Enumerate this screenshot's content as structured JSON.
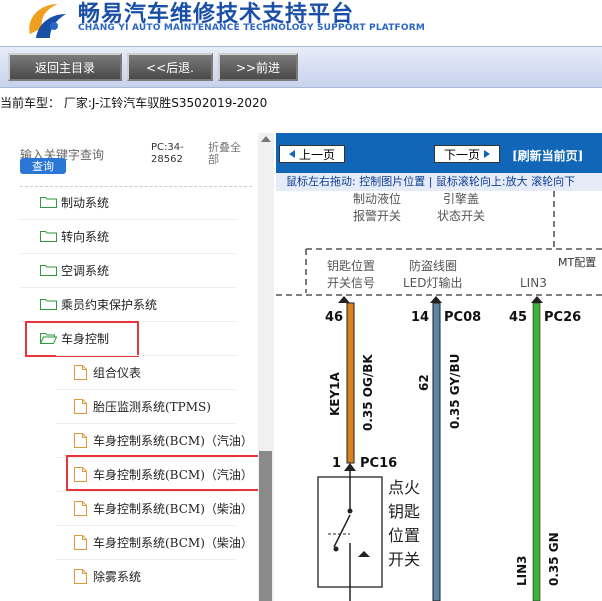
{
  "header": {
    "title": "畅易汽车维修技术支持平台",
    "subtitle": "CHANG YI AUTO MAINTENANCE TECHNOLOGY SUPPORT PLATFORM"
  },
  "nav": {
    "home": "返回主目录",
    "back": "<<后退.",
    "forward": ">>前进"
  },
  "vehicle": "当前车型： 厂家:J-江铃汽车驭胜S3502019-2020",
  "sidebar": {
    "search_hint": "输入关键字查询",
    "search_button": "查询",
    "pc_code": "PC:34-28562",
    "collapse": "折叠全部",
    "systems": [
      "制动系统",
      "转向系统",
      "空调系统",
      "乘员约束保护系统",
      "车身控制"
    ],
    "subitems": [
      "组合仪表",
      "胎压监测系统(TPMS)",
      "车身控制系统(BCM)（汽油）",
      "车身控制系统(BCM)（汽油）",
      "车身控制系统(BCM)（柴油）",
      "车身控制系统(BCM)（柴油）",
      "除雾系统"
    ]
  },
  "diagram": {
    "prev_page": "上一页",
    "next_page": "下一页",
    "refresh": "[刷新当前页]",
    "hint": "鼠标左右拖动: 控制图片位置 | 鼠标滚轮向上:放大  滚轮向下",
    "labels": {
      "brake_fluid": [
        "制动液位",
        "报警开关"
      ],
      "hood": [
        "引擎盖",
        "状态开关"
      ],
      "key_pos": [
        "钥匙位置",
        "开关信号"
      ],
      "antitheft": [
        "防盗线圈",
        "LED灯输出"
      ],
      "lin3_top": "LIN3",
      "mt": "MT配置",
      "pin46": "46",
      "pin14": "14",
      "pin45": "45",
      "pc08": "PC08",
      "pc26": "PC26",
      "key1a": "KEY1A",
      "wire_og": "0.35 OG/BK",
      "wire62": "62",
      "wire_gy": "0.35 GY/BU",
      "pin1": "1",
      "pc16": "PC16",
      "switch_name": [
        "点火",
        "钥匙",
        "位置",
        "开关"
      ],
      "lin3_bottom": "LIN3",
      "wire_gn": "0.35 GN"
    }
  },
  "colors": {
    "brand_blue": "#1a4fa8",
    "panel_blue": "#1166b8",
    "highlight_red": "#e8343a",
    "wire_orange": "#d9821f",
    "wire_gray_blue": "#5a87a8",
    "wire_green": "#3cb43c"
  }
}
